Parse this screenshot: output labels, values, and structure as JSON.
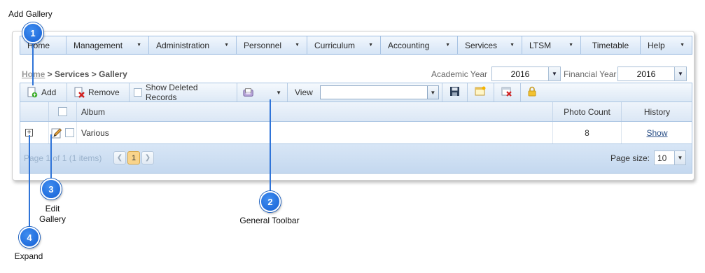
{
  "title": "Add Gallery",
  "menu": {
    "items": [
      {
        "label": "Home",
        "has_arrow": false
      },
      {
        "label": "Management",
        "has_arrow": true
      },
      {
        "label": "Administration",
        "has_arrow": true
      },
      {
        "label": "Personnel",
        "has_arrow": true
      },
      {
        "label": "Curriculum",
        "has_arrow": true
      },
      {
        "label": "Accounting",
        "has_arrow": true
      },
      {
        "label": "Services",
        "has_arrow": true
      },
      {
        "label": "LTSM",
        "has_arrow": true
      },
      {
        "label": "Timetable",
        "has_arrow": false
      },
      {
        "label": "Help",
        "has_arrow": true
      }
    ]
  },
  "breadcrumb": {
    "home": "Home",
    "rest": " > Services > Gallery"
  },
  "academic_year": {
    "label": "Academic Year",
    "value": "2016"
  },
  "financial_year": {
    "label": "Financial Year",
    "value": "2016"
  },
  "toolbar": {
    "add_label": "Add",
    "remove_label": "Remove",
    "show_deleted_label": "Show Deleted Records",
    "view_label": "View",
    "view_value": ""
  },
  "grid": {
    "headers": {
      "album": "Album",
      "photo_count": "Photo Count",
      "history": "History"
    },
    "rows": [
      {
        "album": "Various",
        "photo_count": "8",
        "history": "Show"
      }
    ]
  },
  "pager": {
    "info": "Page 1 of 1 (1 items)",
    "current_page": "1",
    "page_size_label": "Page size:",
    "page_size_value": "10"
  },
  "callouts": [
    {
      "number": "1"
    },
    {
      "number": "2",
      "caption": "General Toolbar"
    },
    {
      "number": "3",
      "caption": "Edit\nGallery"
    },
    {
      "number": "4",
      "caption": "Expand"
    }
  ],
  "colors": {
    "accent": "#1560d4",
    "menu_bg": "#d6e5f6",
    "current_page": "#f9d48b"
  }
}
